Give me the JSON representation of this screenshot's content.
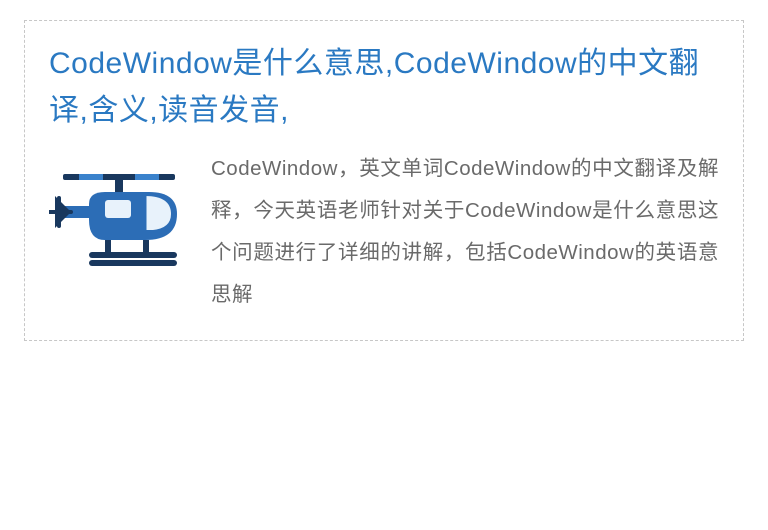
{
  "article": {
    "title": "CodeWindow是什么意思,CodeWindow的中文翻译,含义,读音发音,",
    "body": "CodeWindow，英文单词CodeWindow的中文翻译及解释，今天英语老师针对关于CodeWindow是什么意思这个问题进行了详细的讲解，包括CodeWindow的英语意思解",
    "icon_name": "helicopter-icon"
  },
  "colors": {
    "title": "#2a79c2",
    "body": "#6a6a6a",
    "heli_body": "#2c6db6",
    "heli_dark": "#19385e"
  }
}
